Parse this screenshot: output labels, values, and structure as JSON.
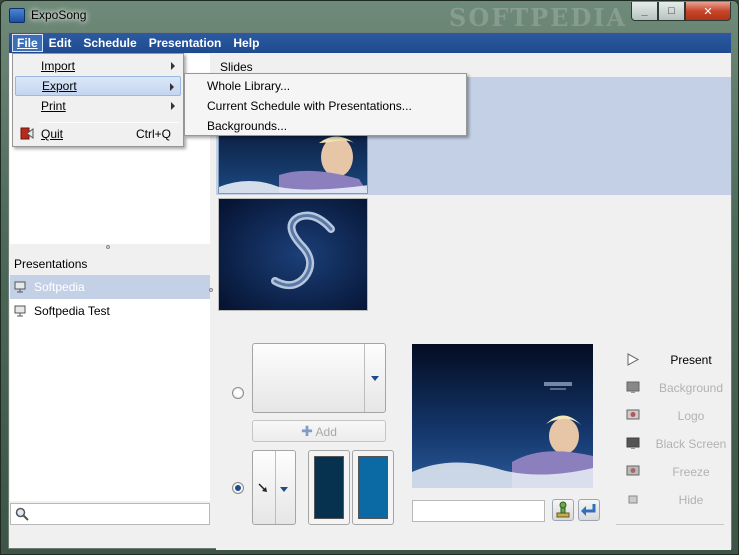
{
  "window": {
    "title": "ExpoSong",
    "watermark": "SOFTPEDIA",
    "controls": {
      "minimize": "_",
      "maximize": "□",
      "close": "✕"
    }
  },
  "menubar": {
    "items": [
      {
        "label": "File",
        "active": true
      },
      {
        "label": "Edit"
      },
      {
        "label": "Schedule"
      },
      {
        "label": "Presentation"
      },
      {
        "label": "Help"
      }
    ]
  },
  "file_menu": {
    "items": [
      {
        "label": "Import",
        "submenu": true
      },
      {
        "label": "Export",
        "submenu": true,
        "highlighted": true
      },
      {
        "label": "Print",
        "submenu": true
      },
      {
        "label": "Quit",
        "shortcut": "Ctrl+Q",
        "icon": "quit-icon"
      }
    ]
  },
  "export_submenu": {
    "items": [
      {
        "label": "Whole Library..."
      },
      {
        "label": "Current Schedule with Presentations..."
      },
      {
        "label": "Backgrounds..."
      }
    ]
  },
  "slides_panel": {
    "label": "Slides"
  },
  "presentations": {
    "header": "Presentations",
    "items": [
      {
        "label": "Softpedia",
        "selected": true
      },
      {
        "label": "Softpedia Test",
        "selected": false
      }
    ]
  },
  "search": {
    "value": "",
    "placeholder": ""
  },
  "slide_controls": {
    "add_label": "Add",
    "swatch_colors": [
      "#06324f",
      "#0b6aa4"
    ]
  },
  "present_controls": {
    "items": [
      {
        "label": "Present",
        "enabled": true,
        "icon": "play-icon"
      },
      {
        "label": "Background",
        "enabled": false,
        "icon": "background-icon"
      },
      {
        "label": "Logo",
        "enabled": false,
        "icon": "logo-icon"
      },
      {
        "label": "Black Screen",
        "enabled": false,
        "icon": "black-screen-icon"
      },
      {
        "label": "Freeze",
        "enabled": false,
        "icon": "freeze-icon"
      },
      {
        "label": "Hide",
        "enabled": false,
        "icon": "hide-icon"
      }
    ]
  },
  "preview": {
    "caption_text": ""
  },
  "colors": {
    "menubar": "#1f4a8f",
    "selection": "#c4d0e6",
    "slide_bg": "#0d1d3c"
  }
}
